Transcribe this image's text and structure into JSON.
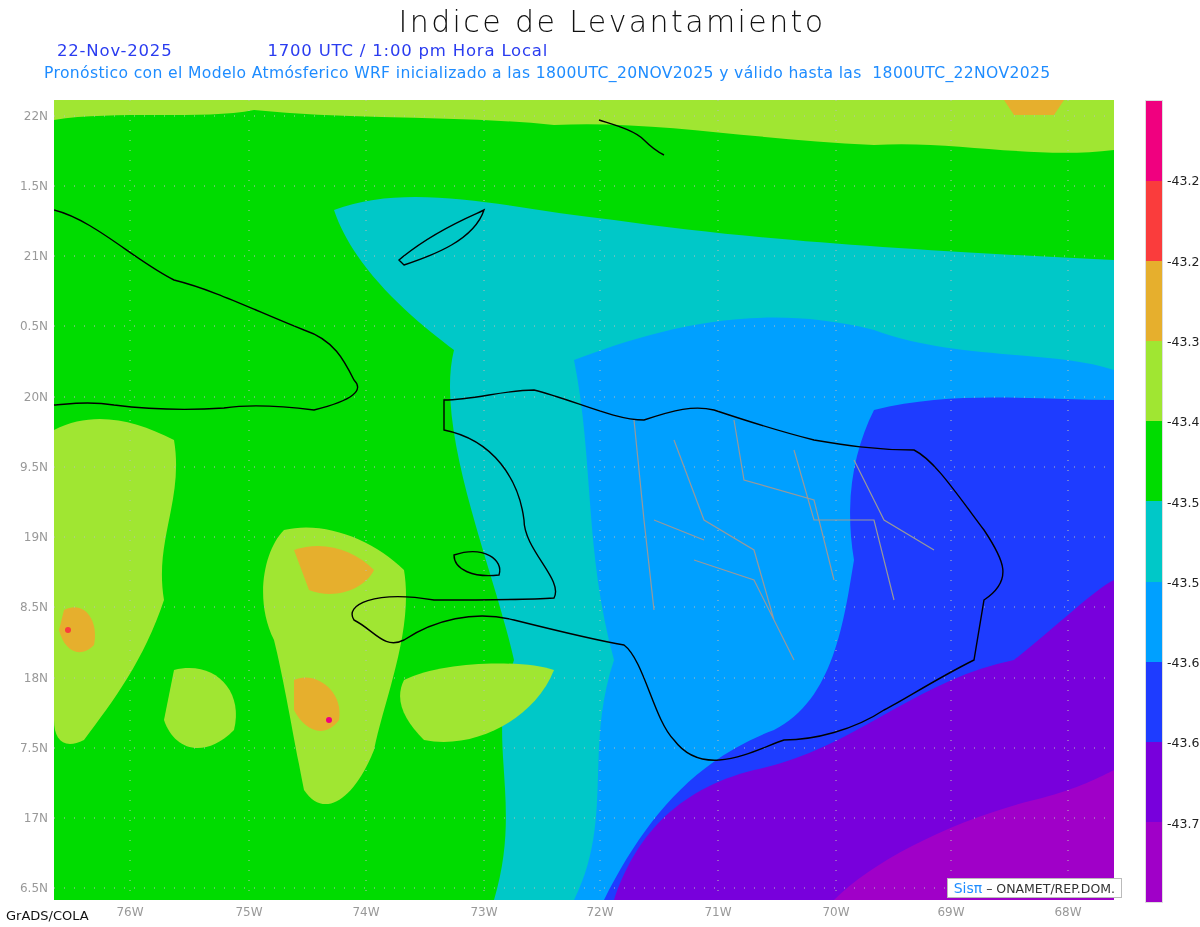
{
  "title": "Indice de Levantamiento",
  "date": "22-Nov-2025",
  "time": "1700 UTC / 1:00 pm Hora Local",
  "subtitle": "Pronóstico con el Modelo Atmósferico WRF inicializado a las 1800UTC_20NOV2025 y válido hasta las  1800UTC_22NOV2025",
  "map": {
    "y_labels": [
      "22N",
      "1.5N",
      "21N",
      "0.5N",
      "20N",
      "9.5N",
      "19N",
      "8.5N",
      "18N",
      "7.5N",
      "17N",
      "6.5N"
    ],
    "x_labels": [
      "76W",
      "75W",
      "74W",
      "73W",
      "72W",
      "71W",
      "70W",
      "69W",
      "68W"
    ],
    "credit": {
      "logo": "Sisπ",
      "text": "– ONAMET/REP.DOM."
    }
  },
  "colorbar": {
    "segments": [
      {
        "color": "#f0007f"
      },
      {
        "color": "#fa3c3c"
      },
      {
        "color": "#e6af2d"
      },
      {
        "color": "#a0e632"
      },
      {
        "color": "#00dc00"
      },
      {
        "color": "#00c8c8"
      },
      {
        "color": "#00a0ff"
      },
      {
        "color": "#1e3cff"
      },
      {
        "color": "#7800dc"
      },
      {
        "color": "#a000c8"
      }
    ],
    "labels": [
      "-43.2",
      "-43.2",
      "-43.3",
      "-43.4",
      "-43.5",
      "-43.5",
      "-43.6",
      "-43.6",
      "-43.7"
    ]
  },
  "footer": "GrADS/COLA"
}
